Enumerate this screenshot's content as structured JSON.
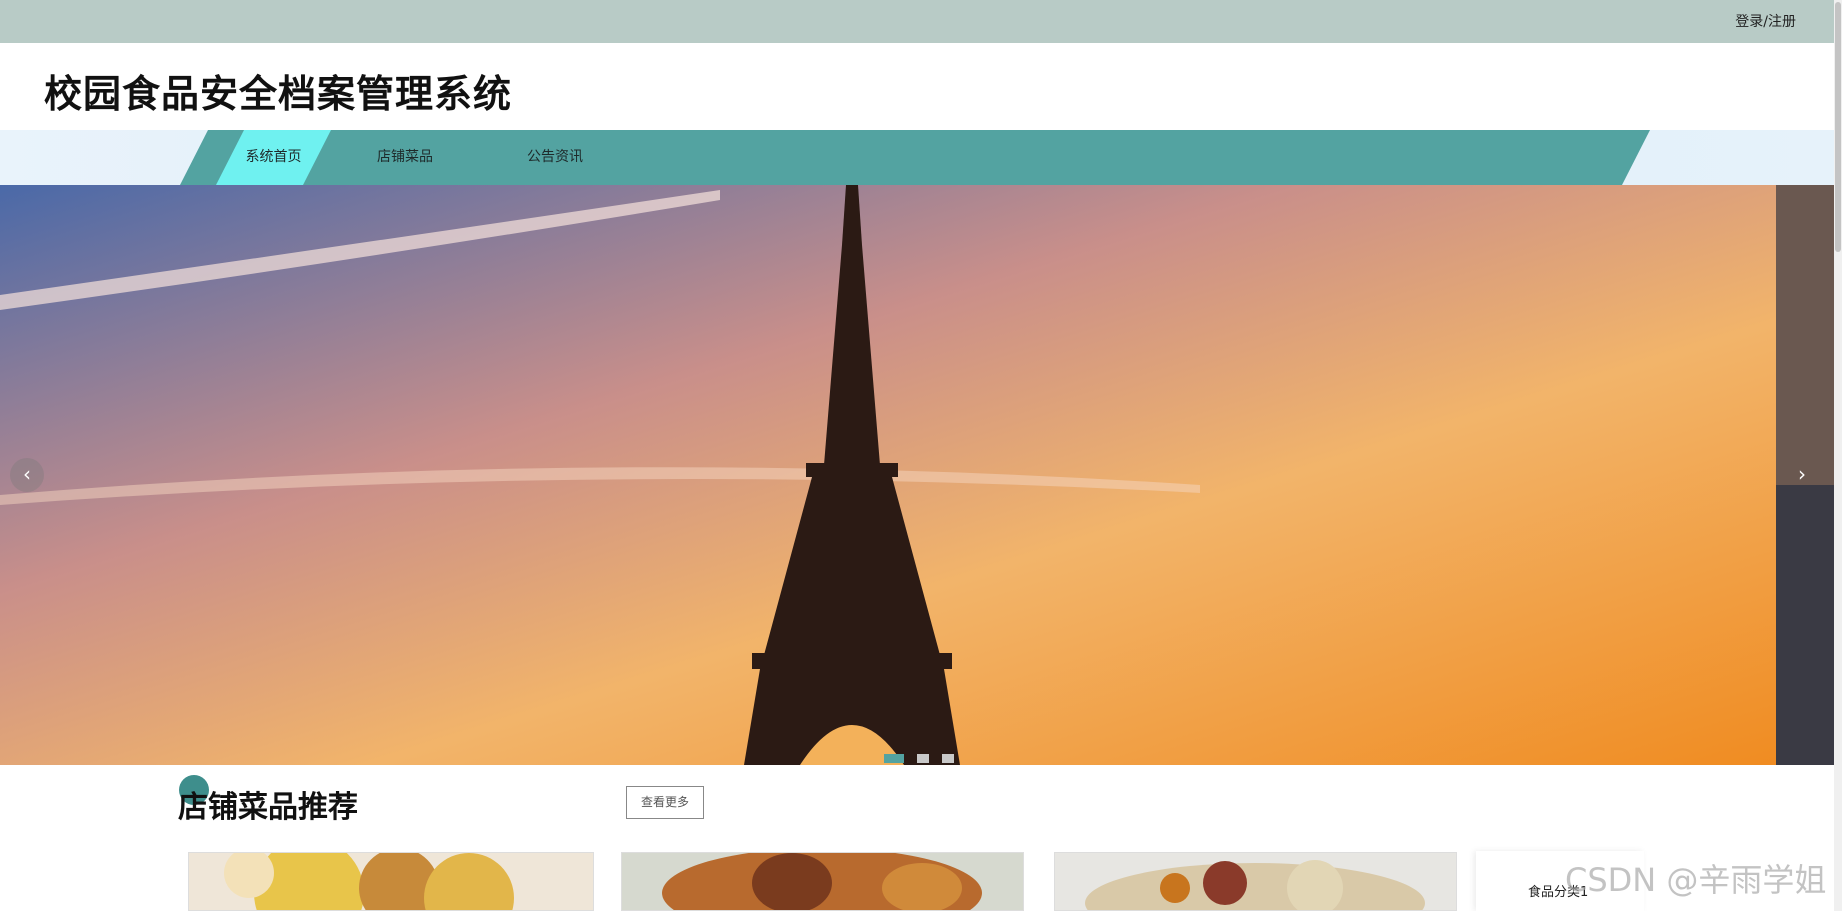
{
  "topbar": {
    "login_label": "登录/注册"
  },
  "header": {
    "title": "校园食品安全档案管理系统"
  },
  "nav": {
    "items": [
      "系统首页",
      "店铺菜品",
      "公告资讯"
    ],
    "active_index": 0
  },
  "banner": {
    "prev_icon": "‹",
    "next_icon": "›",
    "slide_count": 3,
    "active_slide": 0
  },
  "section": {
    "title": "店铺菜品推荐",
    "more_label": "查看更多"
  },
  "sidebar": {
    "category_label": "食品分类1"
  },
  "watermark": "CSDN @辛雨学姐",
  "colors": {
    "accent": "#53a3a1",
    "active_nav": "#6ff1f0",
    "topbar": "#b8cbc6"
  }
}
